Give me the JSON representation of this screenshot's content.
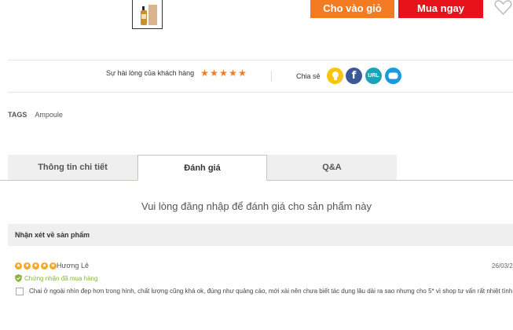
{
  "product": {
    "thumbnail_icon": "serum-bottle-icon"
  },
  "actions": {
    "add_to_cart_label": "Cho vào giỏ",
    "buy_now_label": "Mua ngay",
    "wishlist_icon": "heart-icon"
  },
  "satisfaction": {
    "label": "Sự hài lòng của khách hàng",
    "stars": 5
  },
  "share": {
    "label": "Chia sẻ",
    "url_label": "URL",
    "fb_label": "f"
  },
  "tags": {
    "label": "TAGS",
    "value": "Ampoule"
  },
  "tabs": [
    {
      "label": "Thông tin chi tiết"
    },
    {
      "label": "Đánh giá"
    },
    {
      "label": "Q&A"
    }
  ],
  "login_message": "Vui lòng đăng nhập để đánh giá cho sản phẩm này",
  "reviews": {
    "header": "Nhận xét về sản phẩm",
    "items": [
      {
        "stars": 5,
        "name": "Hương Lê",
        "date": "26/03/20",
        "verified_label": "Chứng nhận đã mua hàng",
        "text": "Chai ở ngoài nhìn đẹp hơn trong hình, chất lượng cũng khá ok, đúng như quảng cáo, mới xài nên chưa biết tác dụng lâu dài ra sao nhưng cho 5* vì shop tư vấn rất nhiệt tình"
      }
    ]
  },
  "colors": {
    "cart_orange": "#f37b22",
    "buy_red": "#e8131a",
    "tab_border": "#c7d08a",
    "verified_green": "#8ab43c"
  }
}
